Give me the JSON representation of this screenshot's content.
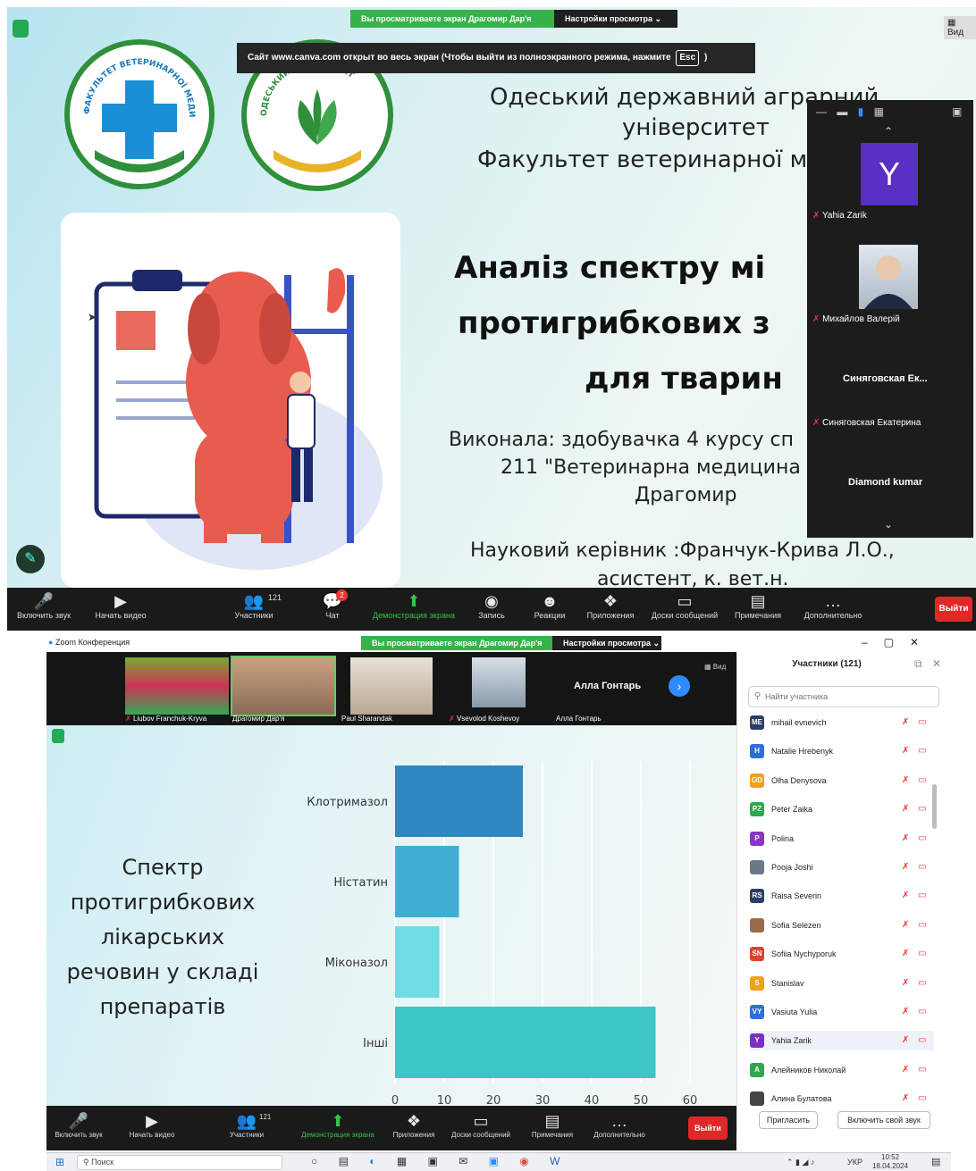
{
  "top": {
    "share_banner": "Вы просматриваете экран Драгомир Дар'я",
    "view_options": "Настройки просмотра",
    "fullscreen_notice_pre": "Сайт www.canva.com открыт во весь экран (Чтобы выйти из полноэкранного режима, нажмите",
    "fullscreen_notice_key": "Esc",
    "fullscreen_notice_post": ")",
    "view_label": "Вид",
    "slide": {
      "university_line1": "Одеський державний аграрний",
      "university_line2": "університет",
      "faculty": "Факультет ветеринарної ме",
      "title_line1": "Аналіз спектру мі",
      "title_line2": "протигрибкових з",
      "title_line3": "для тварин",
      "author_line1": "Виконала: здобувачка 4 курсу сп",
      "author_line2": "211 \"Ветеринарна медицина",
      "author_line3": "Драгомир",
      "advisor_line1": "Науковий керівник :Франчук-Крива Л.О.,",
      "advisor_line2": "асистент, к. вет.н.",
      "logo1_text": "ФАКУЛЬТЕТ ВЕТЕРИНАРНОЇ МЕДИЦИНИ",
      "logo2_text": "ОДЕСЬКИЙ УНІВЕРСИТЕТ"
    },
    "gallery": {
      "tile1_letter": "Y",
      "tile1_name": "Yahia Zarik",
      "tile2_name": "Михайлов Валерій",
      "tile3_label": "Синяговская Ек...",
      "tile3_name": "Синяговская Екатерина",
      "tile4_label": "Diamond kumar"
    },
    "toolbar": {
      "audio": "Включить звук",
      "video": "Начать видео",
      "participants": "Участники",
      "participants_count": "121",
      "chat": "Чат",
      "chat_badge": "2",
      "share": "Демонстрация экрана",
      "record": "Запись",
      "reactions": "Реакции",
      "apps": "Приложения",
      "whiteboards": "Доски сообщений",
      "notes": "Примечания",
      "more": "Дополнительно",
      "leave": "Выйти"
    }
  },
  "bottom": {
    "window_title": "Zoom Конференция",
    "share_banner": "Вы просматриваете экран Драгомир Дар'я",
    "view_options": "Настройки просмотра",
    "view_label": "Вид",
    "strip": [
      {
        "name": "Liubov Franchuk-Kryva"
      },
      {
        "name": "Драгомир Дар'я"
      },
      {
        "name": "Paul Sharandak"
      },
      {
        "name": "Vsevolod Koshevoy"
      },
      {
        "name": "Алла Гонтарь",
        "label": "Алла Гонтарь"
      }
    ],
    "slide_text": [
      "Спектр",
      "протигрибкових",
      "лікарських",
      "речовин у складі",
      "препаратів"
    ],
    "participants_panel": {
      "title": "Участники (121)",
      "search_placeholder": "Найти участника",
      "invite": "Пригласить",
      "unmute_me": "Включить свой звук",
      "people": [
        {
          "initials": "ME",
          "name": "mihail evnevich",
          "color": "#2a3f66"
        },
        {
          "initials": "H",
          "name": "Natalie Hrebenyk",
          "color": "#2d6fd8"
        },
        {
          "initials": "OD",
          "name": "Olha Denysova",
          "color": "#f0a21c"
        },
        {
          "initials": "PZ",
          "name": "Peter Zaika",
          "color": "#2ea84a"
        },
        {
          "initials": "P",
          "name": "Polina",
          "color": "#8a35c9"
        },
        {
          "initials": "",
          "name": "Pooja Joshi",
          "color": "#6a7a88"
        },
        {
          "initials": "RS",
          "name": "Raisa Severin",
          "color": "#2a3f66"
        },
        {
          "initials": "",
          "name": "Sofia Selezen",
          "color": "#9b6a4a"
        },
        {
          "initials": "SN",
          "name": "Sofiia Nychyporuk",
          "color": "#d9452b"
        },
        {
          "initials": "S",
          "name": "Stanislav",
          "color": "#f0a21c"
        },
        {
          "initials": "VY",
          "name": "Vasiuta Yulia",
          "color": "#2d6fd8"
        },
        {
          "initials": "Y",
          "name": "Yahia Zarik",
          "color": "#7a2fc4"
        },
        {
          "initials": "A",
          "name": "Алейников Николай",
          "color": "#2ea84a"
        },
        {
          "initials": "",
          "name": "Алина Булатова",
          "color": "#444"
        }
      ]
    },
    "toolbar": {
      "audio": "Включить звук",
      "video": "Начать видео",
      "participants": "Участники",
      "participants_count": "121",
      "share": "Демонстрация экрана",
      "apps": "Приложения",
      "whiteboards": "Доски сообщений",
      "notes": "Примечания",
      "more": "Дополнительно",
      "leave": "Выйти"
    },
    "taskbar": {
      "search": "Поиск",
      "lang": "УКР",
      "time": "10:52",
      "date": "18.04.2024"
    }
  },
  "chart_data": {
    "type": "bar",
    "orientation": "horizontal",
    "categories": [
      "Клотримазол",
      "Ністатин",
      "Міконазол",
      "Інші"
    ],
    "values": [
      26,
      13,
      9,
      53
    ],
    "xlim": [
      0,
      60
    ],
    "xticks": [
      0,
      10,
      20,
      30,
      40,
      50,
      60
    ],
    "colors": [
      "#2e88bf",
      "#3fb0d3",
      "#6fdbe5",
      "#3cc6c6"
    ],
    "grid": true
  }
}
